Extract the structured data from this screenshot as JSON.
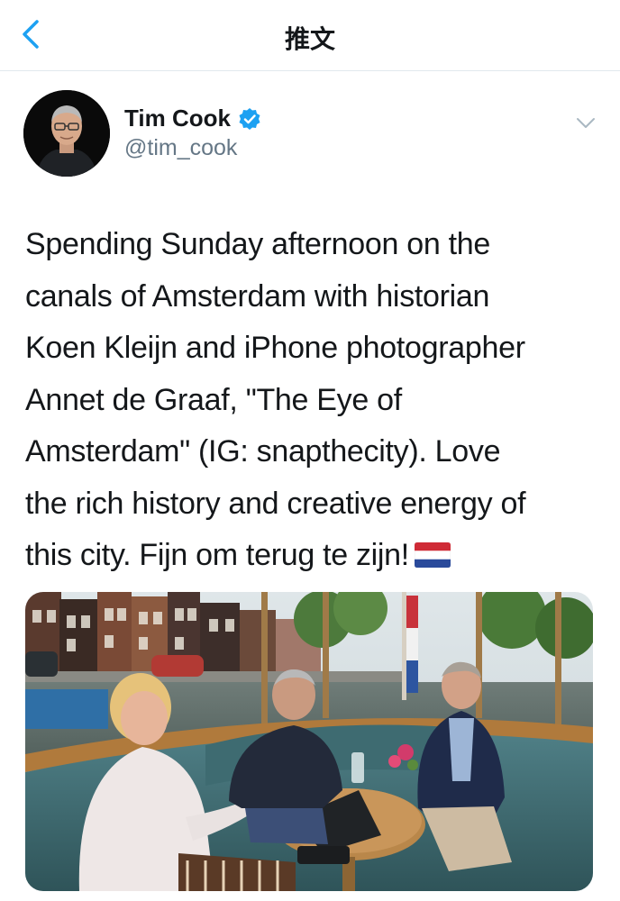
{
  "nav": {
    "title": "推文",
    "back_icon": "chevron-left-icon"
  },
  "tweet": {
    "author_name": "Tim Cook",
    "author_handle": "@tim_cook",
    "verified": true,
    "text_lines": [
      "Spending Sunday afternoon on the",
      "canals of Amsterdam with historian",
      "Koen Kleijn and iPhone photographer",
      "Annet de Graaf, \"The Eye of",
      "Amsterdam\" (IG: snapthecity). Love",
      "the rich history and creative energy of",
      "this city. Fijn om terug te zijn!"
    ],
    "emoji": "netherlands-flag-icon"
  },
  "colors": {
    "accent": "#1da1f2",
    "text": "#14171a",
    "secondary": "#657786",
    "divider": "#e1e8ed"
  }
}
